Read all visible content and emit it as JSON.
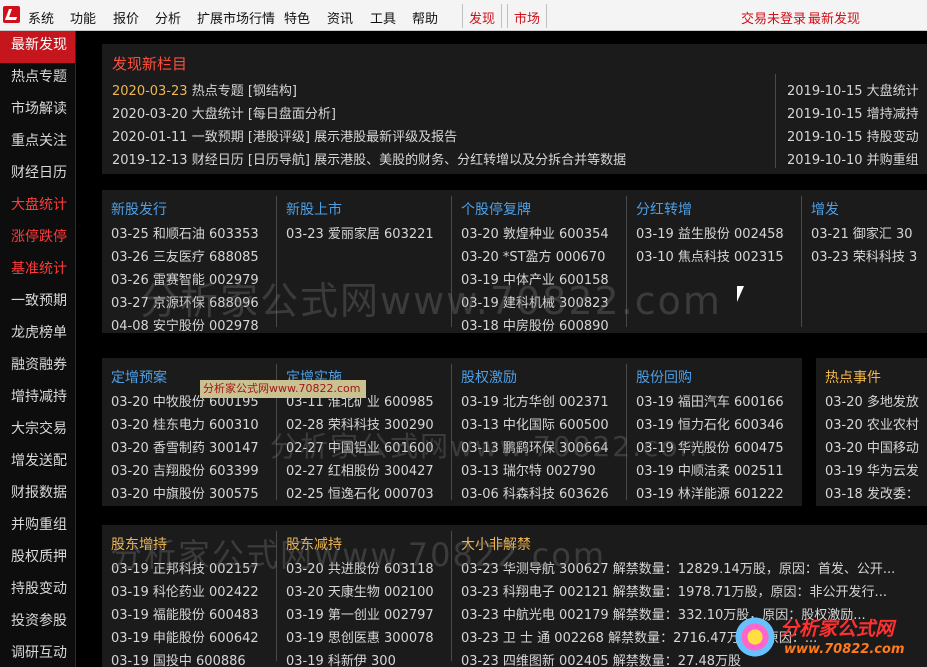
{
  "menu": {
    "items": [
      "系统",
      "功能",
      "报价",
      "分析",
      "扩展市场行情",
      "特色",
      "资讯",
      "工具",
      "帮助"
    ],
    "boxed": [
      "发现",
      "市场"
    ],
    "right": [
      "交易未登录",
      "最新发现"
    ]
  },
  "sidebar": {
    "items": [
      {
        "label": "最新发现",
        "style": "active"
      },
      {
        "label": "热点专题",
        "style": ""
      },
      {
        "label": "市场解读",
        "style": ""
      },
      {
        "label": "重点关注",
        "style": ""
      },
      {
        "label": "财经日历",
        "style": ""
      },
      {
        "label": "大盘统计",
        "style": "red"
      },
      {
        "label": "涨停跌停",
        "style": "red"
      },
      {
        "label": "基准统计",
        "style": "red"
      },
      {
        "label": "一致预期",
        "style": ""
      },
      {
        "label": "龙虎榜单",
        "style": ""
      },
      {
        "label": "融资融券",
        "style": ""
      },
      {
        "label": "增持减持",
        "style": ""
      },
      {
        "label": "大宗交易",
        "style": ""
      },
      {
        "label": "增发送配",
        "style": ""
      },
      {
        "label": "财报数据",
        "style": ""
      },
      {
        "label": "并购重组",
        "style": ""
      },
      {
        "label": "股权质押",
        "style": ""
      },
      {
        "label": "持股变动",
        "style": ""
      },
      {
        "label": "投资参股",
        "style": ""
      },
      {
        "label": "调研互动",
        "style": ""
      }
    ]
  },
  "discover": {
    "title": "发现新栏目",
    "left": [
      {
        "date": "2020-03-23",
        "text": " 热点专题 [钢结构]",
        "hl": true
      },
      {
        "date": "2020-03-20",
        "text": " 大盘统计 [每日盘面分析]",
        "hl": false
      },
      {
        "date": "2020-01-11",
        "text": " 一致预期 [港股评级]  展示港股最新评级及报告",
        "hl": false
      },
      {
        "date": "2019-12-13",
        "text": " 财经日历 [日历导航]  展示港股、美股的财务、分红转增以及分拆合并等数据",
        "hl": false
      }
    ],
    "right": [
      "2019-10-15 大盘统计",
      "2019-10-15 增持减持",
      "2019-10-15 持股变动",
      "2019-10-10 并购重组"
    ]
  },
  "section1": [
    {
      "title": "新股发行",
      "rows": [
        "03-25  和顺石油  603353",
        "03-26  三友医疗  688085",
        "03-26  雷赛智能  002979",
        "03-27  京源环保  688096",
        "04-08  安宁股份  002978"
      ]
    },
    {
      "title": "新股上市",
      "rows": [
        "03-23  爱丽家居  603221"
      ]
    },
    {
      "title": "个股停复牌",
      "rows": [
        "03-20  敦煌种业  600354",
        "03-20  *ST盈方  000670",
        "03-19  中体产业  600158",
        "03-19  建科机械  300823",
        "03-18  中房股份  600890"
      ]
    },
    {
      "title": "分红转增",
      "rows": [
        "03-19  益生股份  002458",
        "03-10  焦点科技  002315"
      ]
    },
    {
      "title": "增发",
      "rows": [
        "03-21  御家汇  30",
        "03-23  荣科科技  3"
      ]
    }
  ],
  "section2": [
    {
      "title": "定增预案",
      "rows": [
        "03-20  中牧股份  600195",
        "03-20  桂东电力  600310",
        "03-20  香雪制药  300147",
        "03-20  吉翔股份  603399",
        "03-20  中旗股份  300575"
      ]
    },
    {
      "title": "定增实施",
      "rows": [
        "03-11  淮北矿业  600985",
        "02-28  荣科科技  300290",
        "02-27  中国铝业  601600",
        "02-27  红相股份  300427",
        "02-25  恒逸石化  000703"
      ]
    },
    {
      "title": "股权激励",
      "rows": [
        "03-19  北方华创  002371",
        "03-13  中化国际  600500",
        "03-13  鹏鹞环保  300664",
        "03-13  瑞尔特  002790",
        "03-06  科森科技  603626"
      ]
    },
    {
      "title": "股份回购",
      "rows": [
        "03-19  福田汽车  600166",
        "03-19  恒力石化  600346",
        "03-19  华光股份  600475",
        "03-19  中顺洁柔  002511",
        "03-19  林洋能源  601222"
      ]
    },
    {
      "title": "热点事件",
      "rows": [
        "03-20  多地发放",
        "03-20  农业农村",
        "03-20  中国移动",
        "03-19  华为云发",
        "03-18  发改委："
      ]
    }
  ],
  "section3": [
    {
      "title": "股东增持",
      "rows": [
        "03-19  正邦科技  002157",
        "03-19  科伦药业  002422",
        "03-19  福能股份  600483",
        "03-19  申能股份  600642",
        "03-19  国投中  600886"
      ]
    },
    {
      "title": "股东减持",
      "rows": [
        "03-20  共进股份  603118",
        "03-20  天康生物  002100",
        "03-19  第一创业  002797",
        "03-19  思创医惠  300078",
        "03-19  科新伊  300"
      ]
    },
    {
      "title": "大小非解禁",
      "rows": [
        "03-23  华测导航  300627  解禁数量：12829.14万股，原因：首发、公开...",
        "03-23  科翔电子  002121  解禁数量：1978.71万股，原因：非公开发行...",
        "03-23  中航光电  002179  解禁数量：332.10万股，原因：股权激励...",
        "03-23  卫 士 通  002268  解禁数量：2716.47万股，原因：...",
        "03-23  四维图新  002405  解禁数量：27.48万股"
      ]
    }
  ],
  "watermark": {
    "text1": "分析家公式网www.70822.com",
    "tag": "分析家公式网www.70822.com",
    "logo_title": "分析家公式网",
    "logo_url": "www.70822.com"
  }
}
